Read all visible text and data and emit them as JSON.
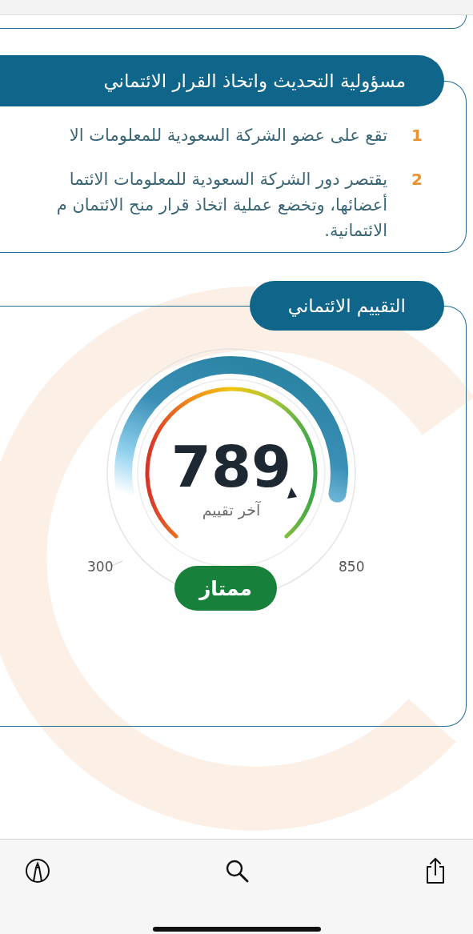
{
  "responsibility": {
    "title": "مسؤولية التحديث واتخاذ القرار الائتماني",
    "items": [
      {
        "number": "1",
        "lines": [
          "تقع على عضو الشركة السعودية للمعلومات الا"
        ]
      },
      {
        "number": "2",
        "lines": [
          "يقتصر دور الشركة السعودية للمعلومات الائتما",
          "أعضائها، وتخضع عملية اتخاذ قرار منح الائتمان م",
          "الائتمانية."
        ]
      }
    ]
  },
  "rating": {
    "title": "التقييم الائتماني",
    "score": "789",
    "caption": "آخر تقييم",
    "min": "300",
    "max": "850",
    "grade": "ممتاز"
  }
}
